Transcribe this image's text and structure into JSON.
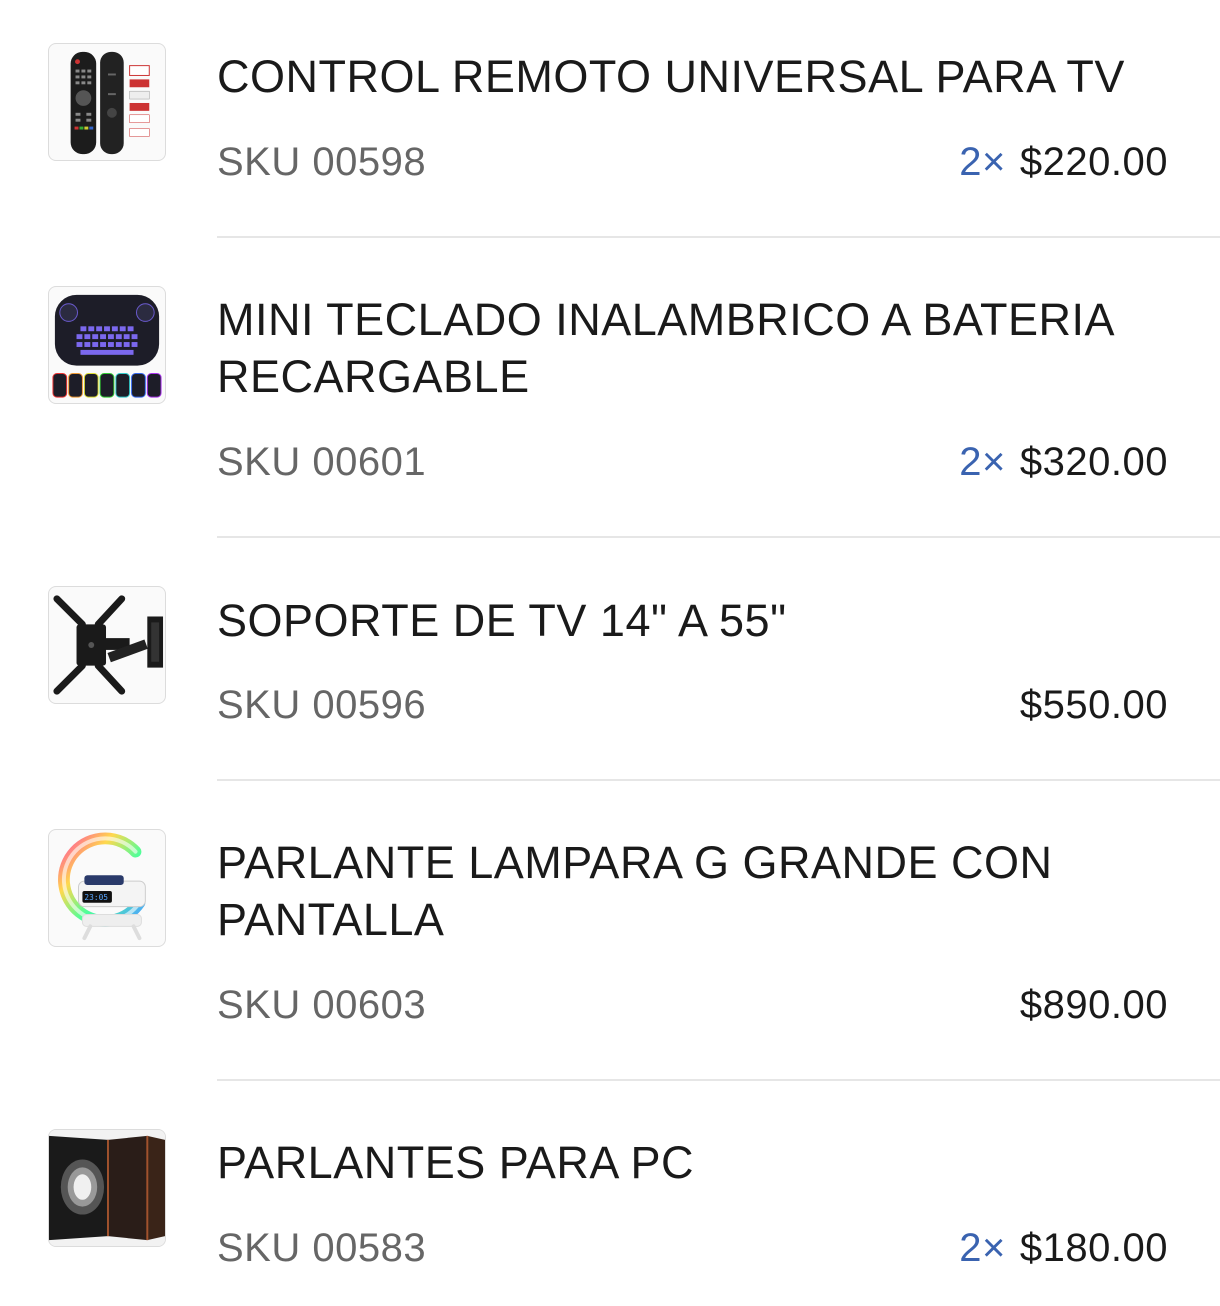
{
  "items": [
    {
      "title": "CONTROL REMOTO  UNIVERSAL PARA TV",
      "sku": "SKU 00598",
      "qty": "2×",
      "price": "$220.00",
      "thumbnail": "tv-remote-image"
    },
    {
      "title": "MINI TECLADO INALAMBRICO A BATERIA RECARGABLE",
      "sku": "SKU 00601",
      "qty": "2×",
      "price": "$320.00",
      "thumbnail": "mini-keyboard-image"
    },
    {
      "title": "SOPORTE DE TV 14\" A 55\"",
      "sku": "SKU 00596",
      "qty": "",
      "price": "$550.00",
      "thumbnail": "tv-mount-image"
    },
    {
      "title": "PARLANTE LAMPARA G GRANDE CON PANTALLA",
      "sku": "SKU 00603",
      "qty": "",
      "price": "$890.00",
      "thumbnail": "g-lamp-speaker-image"
    },
    {
      "title": "PARLANTES PARA PC",
      "sku": "SKU 00583",
      "qty": "2×",
      "price": "$180.00",
      "thumbnail": "pc-speaker-image"
    }
  ],
  "colors": {
    "quantity": "#3a63b0",
    "sku": "#666666",
    "divider": "#e6e6e6"
  }
}
